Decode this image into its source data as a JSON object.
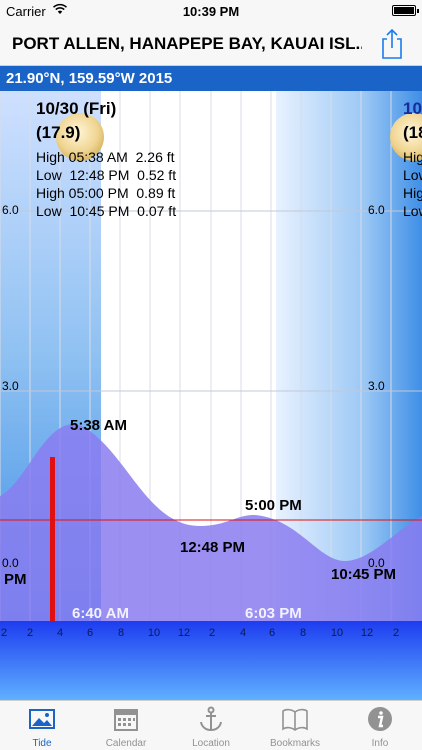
{
  "status": {
    "carrier": "Carrier",
    "time": "10:39 PM"
  },
  "nav": {
    "title": "PORT ALLEN, HANAPEPE BAY, KAUAI ISL..."
  },
  "location": {
    "coords": "21.90°N, 159.59°W 2015"
  },
  "day": {
    "date": "10/30 (Fri)",
    "moon_age": "(17.9)",
    "tides": [
      "High 05:38 AM  2.26 ft",
      "Low  12:48 PM  0.52 ft",
      "High 05:00 PM  0.89 ft",
      "Low  10:45 PM  0.07 ft"
    ]
  },
  "next_day": {
    "date": "10",
    "moon_age": "(18",
    "tides": [
      "Hig",
      "Low",
      "Hig",
      "Low"
    ]
  },
  "axis": {
    "y_top": "6.0",
    "y_mid": "3.0",
    "y_bottom": "0.0"
  },
  "events": {
    "high1": "5:38 AM",
    "low1": "12:48 PM",
    "high2": "5:00 PM",
    "low2": "10:45 PM",
    "prev": "PM",
    "sunrise": "6:40 AM",
    "sunset": "6:03 PM"
  },
  "hour_ticks": [
    "2",
    "2",
    "4",
    "6",
    "8",
    "10",
    "12",
    "2",
    "4",
    "6",
    "8",
    "10",
    "12",
    "2"
  ],
  "tabs": [
    {
      "label": "Tide",
      "icon": "photo-icon"
    },
    {
      "label": "Calendar",
      "icon": "calendar-icon"
    },
    {
      "label": "Location",
      "icon": "anchor-icon"
    },
    {
      "label": "Bookmarks",
      "icon": "book-icon"
    },
    {
      "label": "Info",
      "icon": "info-icon"
    }
  ],
  "colors": {
    "accent": "#1a64c8",
    "tide_fill": "#8a7cf0",
    "current_time": "#e01010"
  }
}
